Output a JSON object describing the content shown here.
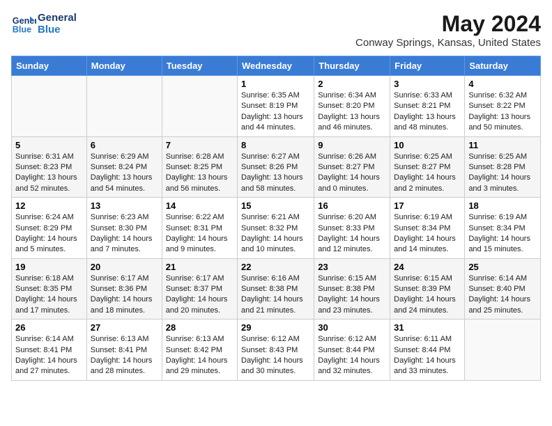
{
  "header": {
    "logo_line1": "General",
    "logo_line2": "Blue",
    "title": "May 2024",
    "subtitle": "Conway Springs, Kansas, United States"
  },
  "columns": [
    "Sunday",
    "Monday",
    "Tuesday",
    "Wednesday",
    "Thursday",
    "Friday",
    "Saturday"
  ],
  "weeks": [
    [
      {
        "day": "",
        "text": ""
      },
      {
        "day": "",
        "text": ""
      },
      {
        "day": "",
        "text": ""
      },
      {
        "day": "1",
        "text": "Sunrise: 6:35 AM\nSunset: 8:19 PM\nDaylight: 13 hours and 44 minutes."
      },
      {
        "day": "2",
        "text": "Sunrise: 6:34 AM\nSunset: 8:20 PM\nDaylight: 13 hours and 46 minutes."
      },
      {
        "day": "3",
        "text": "Sunrise: 6:33 AM\nSunset: 8:21 PM\nDaylight: 13 hours and 48 minutes."
      },
      {
        "day": "4",
        "text": "Sunrise: 6:32 AM\nSunset: 8:22 PM\nDaylight: 13 hours and 50 minutes."
      }
    ],
    [
      {
        "day": "5",
        "text": "Sunrise: 6:31 AM\nSunset: 8:23 PM\nDaylight: 13 hours and 52 minutes."
      },
      {
        "day": "6",
        "text": "Sunrise: 6:29 AM\nSunset: 8:24 PM\nDaylight: 13 hours and 54 minutes."
      },
      {
        "day": "7",
        "text": "Sunrise: 6:28 AM\nSunset: 8:25 PM\nDaylight: 13 hours and 56 minutes."
      },
      {
        "day": "8",
        "text": "Sunrise: 6:27 AM\nSunset: 8:26 PM\nDaylight: 13 hours and 58 minutes."
      },
      {
        "day": "9",
        "text": "Sunrise: 6:26 AM\nSunset: 8:27 PM\nDaylight: 14 hours and 0 minutes."
      },
      {
        "day": "10",
        "text": "Sunrise: 6:25 AM\nSunset: 8:27 PM\nDaylight: 14 hours and 2 minutes."
      },
      {
        "day": "11",
        "text": "Sunrise: 6:25 AM\nSunset: 8:28 PM\nDaylight: 14 hours and 3 minutes."
      }
    ],
    [
      {
        "day": "12",
        "text": "Sunrise: 6:24 AM\nSunset: 8:29 PM\nDaylight: 14 hours and 5 minutes."
      },
      {
        "day": "13",
        "text": "Sunrise: 6:23 AM\nSunset: 8:30 PM\nDaylight: 14 hours and 7 minutes."
      },
      {
        "day": "14",
        "text": "Sunrise: 6:22 AM\nSunset: 8:31 PM\nDaylight: 14 hours and 9 minutes."
      },
      {
        "day": "15",
        "text": "Sunrise: 6:21 AM\nSunset: 8:32 PM\nDaylight: 14 hours and 10 minutes."
      },
      {
        "day": "16",
        "text": "Sunrise: 6:20 AM\nSunset: 8:33 PM\nDaylight: 14 hours and 12 minutes."
      },
      {
        "day": "17",
        "text": "Sunrise: 6:19 AM\nSunset: 8:34 PM\nDaylight: 14 hours and 14 minutes."
      },
      {
        "day": "18",
        "text": "Sunrise: 6:19 AM\nSunset: 8:34 PM\nDaylight: 14 hours and 15 minutes."
      }
    ],
    [
      {
        "day": "19",
        "text": "Sunrise: 6:18 AM\nSunset: 8:35 PM\nDaylight: 14 hours and 17 minutes."
      },
      {
        "day": "20",
        "text": "Sunrise: 6:17 AM\nSunset: 8:36 PM\nDaylight: 14 hours and 18 minutes."
      },
      {
        "day": "21",
        "text": "Sunrise: 6:17 AM\nSunset: 8:37 PM\nDaylight: 14 hours and 20 minutes."
      },
      {
        "day": "22",
        "text": "Sunrise: 6:16 AM\nSunset: 8:38 PM\nDaylight: 14 hours and 21 minutes."
      },
      {
        "day": "23",
        "text": "Sunrise: 6:15 AM\nSunset: 8:38 PM\nDaylight: 14 hours and 23 minutes."
      },
      {
        "day": "24",
        "text": "Sunrise: 6:15 AM\nSunset: 8:39 PM\nDaylight: 14 hours and 24 minutes."
      },
      {
        "day": "25",
        "text": "Sunrise: 6:14 AM\nSunset: 8:40 PM\nDaylight: 14 hours and 25 minutes."
      }
    ],
    [
      {
        "day": "26",
        "text": "Sunrise: 6:14 AM\nSunset: 8:41 PM\nDaylight: 14 hours and 27 minutes."
      },
      {
        "day": "27",
        "text": "Sunrise: 6:13 AM\nSunset: 8:41 PM\nDaylight: 14 hours and 28 minutes."
      },
      {
        "day": "28",
        "text": "Sunrise: 6:13 AM\nSunset: 8:42 PM\nDaylight: 14 hours and 29 minutes."
      },
      {
        "day": "29",
        "text": "Sunrise: 6:12 AM\nSunset: 8:43 PM\nDaylight: 14 hours and 30 minutes."
      },
      {
        "day": "30",
        "text": "Sunrise: 6:12 AM\nSunset: 8:44 PM\nDaylight: 14 hours and 32 minutes."
      },
      {
        "day": "31",
        "text": "Sunrise: 6:11 AM\nSunset: 8:44 PM\nDaylight: 14 hours and 33 minutes."
      },
      {
        "day": "",
        "text": ""
      }
    ]
  ]
}
